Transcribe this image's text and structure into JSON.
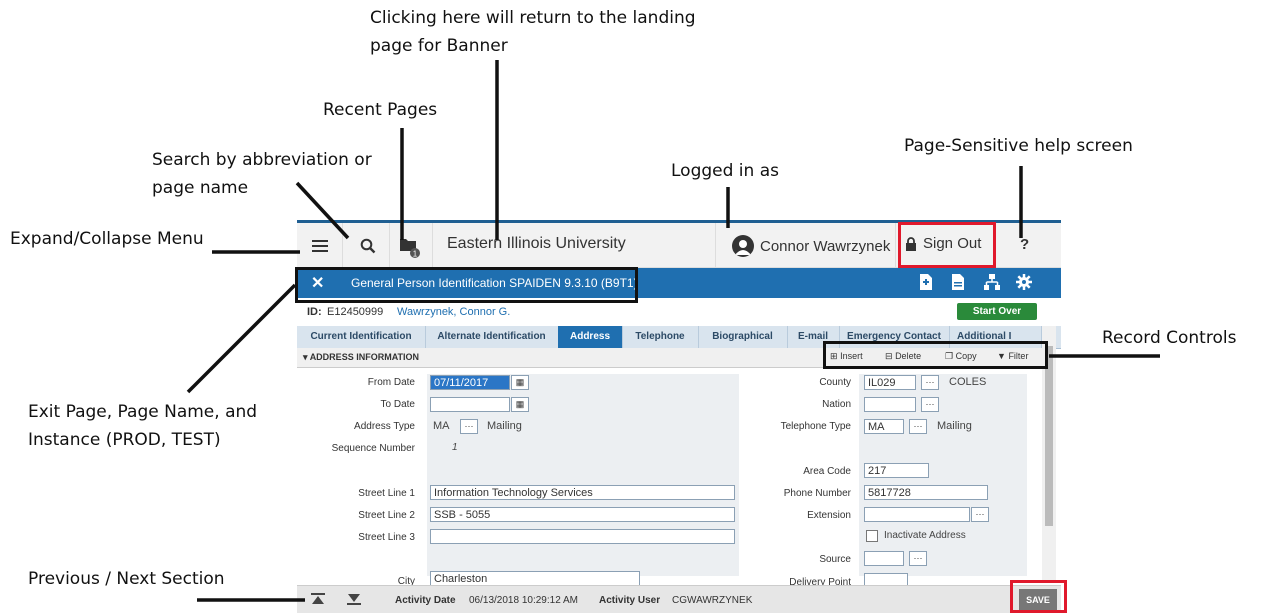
{
  "callouts": {
    "return_landing": "Clicking here will return to the landing page for Banner",
    "recent_pages": "Recent Pages",
    "search": "Search by abbreviation or page name",
    "logged_in": "Logged in as",
    "help_screen": "Page-Sensitive help screen",
    "expand_menu": "Expand/Collapse Menu",
    "record_controls": "Record Controls",
    "exit_page": "Exit Page, Page Name, and Instance (PROD, TEST)",
    "prev_next": "Previous / Next Section"
  },
  "topbar": {
    "institution": "Eastern Illinois University",
    "user_name": "Connor Wawrzynek",
    "sign_out": "Sign Out",
    "help": "?",
    "recent_count": "1"
  },
  "titlebar": {
    "close": "✕",
    "title": "General Person Identification SPAIDEN 9.3.10 (B9T1)"
  },
  "idbar": {
    "id_label": "ID:",
    "id_value": "E12450999",
    "name": "Wawrzynek, Connor G.",
    "start_over": "Start Over"
  },
  "tabs": [
    "Current Identification",
    "Alternate Identification",
    "Address",
    "Telephone",
    "Biographical",
    "E-mail",
    "Emergency Contact",
    "Additional I"
  ],
  "section": {
    "title": "ADDRESS INFORMATION",
    "insert": "Insert",
    "delete": "Delete",
    "copy": "Copy",
    "filter": "Filter"
  },
  "form": {
    "from_date_label": "From Date",
    "from_date": "07/11/2017",
    "to_date_label": "To Date",
    "to_date": "",
    "address_type_label": "Address Type",
    "address_type": "MA",
    "address_type_desc": "Mailing",
    "sequence_label": "Sequence Number",
    "sequence": "1",
    "street1_label": "Street Line 1",
    "street1": "Information Technology Services",
    "street2_label": "Street Line 2",
    "street2": "SSB - 5055",
    "street3_label": "Street Line 3",
    "street3": "",
    "city_label": "City",
    "city": "Charleston",
    "county_label": "County",
    "county": "IL029",
    "county_desc": "COLES",
    "nation_label": "Nation",
    "nation": "",
    "tel_type_label": "Telephone Type",
    "tel_type": "MA",
    "tel_type_desc": "Mailing",
    "area_code_label": "Area Code",
    "area_code": "217",
    "phone_label": "Phone Number",
    "phone": "5817728",
    "extension_label": "Extension",
    "extension": "",
    "inactivate_label": "Inactivate Address",
    "source_label": "Source",
    "source": "",
    "delivery_label": "Delivery Point",
    "delivery": ""
  },
  "bottom": {
    "activity_date_label": "Activity Date",
    "activity_date": "06/13/2018 10:29:12 AM",
    "activity_user_label": "Activity User",
    "activity_user": "CGWAWRZYNEK",
    "save": "SAVE"
  },
  "colors": {
    "banner_blue": "#1f6fb0",
    "highlight_red": "#e0192c",
    "start_over_green": "#2a8a3a"
  }
}
